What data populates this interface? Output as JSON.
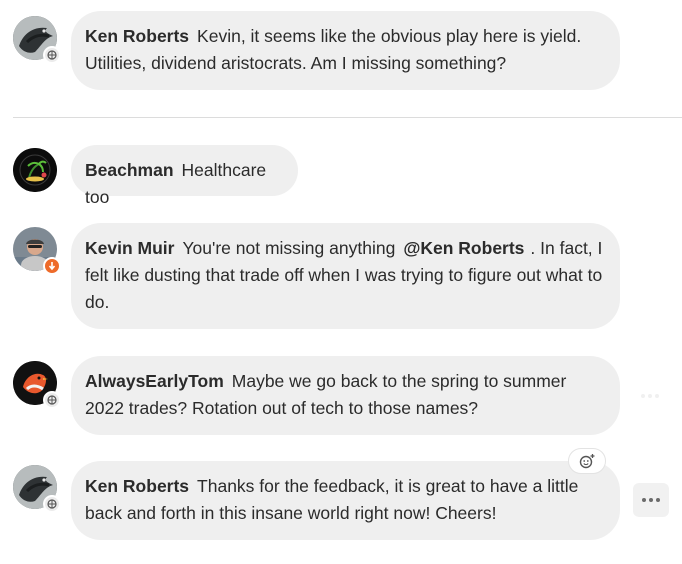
{
  "messages": [
    {
      "author": "Ken Roberts",
      "text": "Kevin, it seems like the obvious play here is yield. Utilities, dividend aristocrats. Am I missing something?",
      "avatar_icon": "dark-bird-avatar",
      "badge_icon": "globe-icon"
    },
    {
      "author": "Beachman",
      "text": "Healthcare too",
      "avatar_icon": "palm-tree-logo-avatar"
    },
    {
      "author": "Kevin Muir",
      "text_before": "You're not missing anything",
      "mention": "@Ken Roberts",
      "text_after": ". In fact, I felt like dusting that trade off when I was trying to figure out what to do.",
      "avatar_icon": "person-photo-avatar",
      "badge_icon": "orange-arrow-badge"
    },
    {
      "author": "AlwaysEarlyTom",
      "text": "Maybe we go back to the spring to summer 2022 trades? Rotation out of tech to those names?",
      "avatar_icon": "red-bird-avatar",
      "badge_icon": "globe-icon"
    },
    {
      "author": "Ken Roberts",
      "text": "Thanks for the feedback, it is great to have a little back and forth in this insane world right now! Cheers!",
      "avatar_icon": "dark-bird-avatar",
      "badge_icon": "globe-icon"
    }
  ],
  "actions": {
    "add_reaction_icon": "add-reaction-icon",
    "more_options_icon": "more-options-icon"
  }
}
